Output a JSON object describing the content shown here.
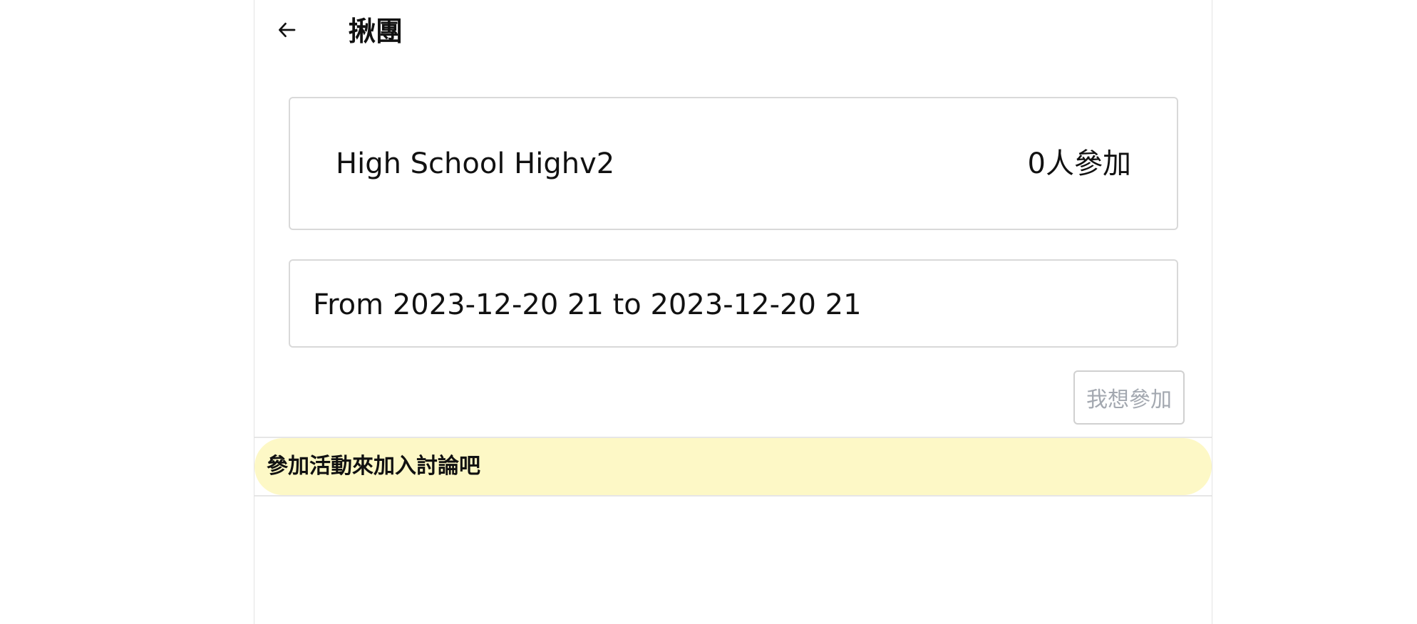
{
  "header": {
    "back_icon": "arrow-left-icon",
    "title": "揪團"
  },
  "event": {
    "name": "High School Highv2",
    "participants": "0人參加"
  },
  "time": {
    "range": "From 2023-12-20 21 to 2023-12-20 21"
  },
  "actions": {
    "join_label": "我想參加",
    "join_disabled": true
  },
  "discussion": {
    "banner": "參加活動來加入討論吧"
  },
  "colors": {
    "banner_bg": "#fdf8c6",
    "disabled_text": "#a3a8b0",
    "border": "#d9d9d9"
  }
}
